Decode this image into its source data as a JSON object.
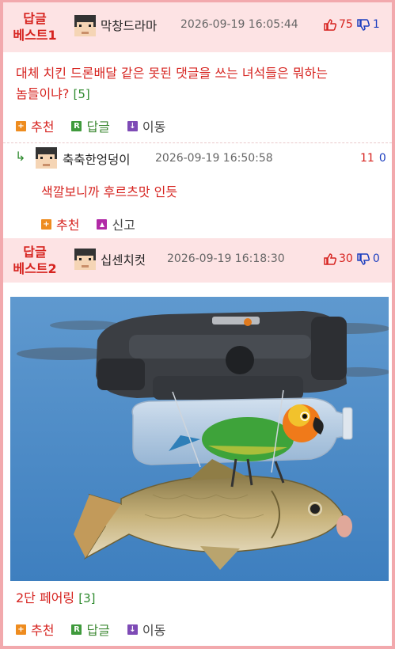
{
  "comments": [
    {
      "best_label_line1": "답글",
      "best_label_line2": "베스트1",
      "nickname": "막창드라마",
      "timestamp": "2026-09-19 16:05:44",
      "upvotes": "75",
      "downvotes": "1",
      "text_line1": "대체 치킨 드론배달 같은 못된 댓글을 쓰는 녀석들은 뭐하는",
      "text_line2": "놈들이냐?",
      "reply_count": "[5]",
      "actions": {
        "recommend": "추천",
        "reply": "답글",
        "move": "이동"
      }
    },
    {
      "nickname": "축축한엉덩이",
      "timestamp": "2026-09-19 16:50:58",
      "upvotes": "11",
      "downvotes": "0",
      "text": "색깔보니까 후르츠맛 인듯",
      "actions": {
        "recommend": "추천",
        "report": "신고"
      }
    },
    {
      "best_label_line1": "답글",
      "best_label_line2": "베스트2",
      "nickname": "십센치컷",
      "timestamp": "2026-09-19 16:18:30",
      "upvotes": "30",
      "downvotes": "0",
      "text": "2단 페어링",
      "reply_count": "[3]",
      "actions": {
        "recommend": "추천",
        "reply": "답글",
        "move": "이동"
      }
    }
  ],
  "icons": {
    "thumbs_up": "thumbs-up-icon",
    "thumbs_down": "thumbs-down-icon",
    "reply_arrow": "reply-arrow-icon",
    "recommend": "plus-icon",
    "reply": "reply-icon",
    "move": "down-arrow-icon",
    "report": "siren-icon"
  },
  "colors": {
    "accent_red": "#d6231f",
    "best_header_bg": "#fde3e4",
    "border_pink": "#f2a9ad",
    "downvote_blue": "#1d3fbf",
    "count_green": "#2e8a2e"
  }
}
